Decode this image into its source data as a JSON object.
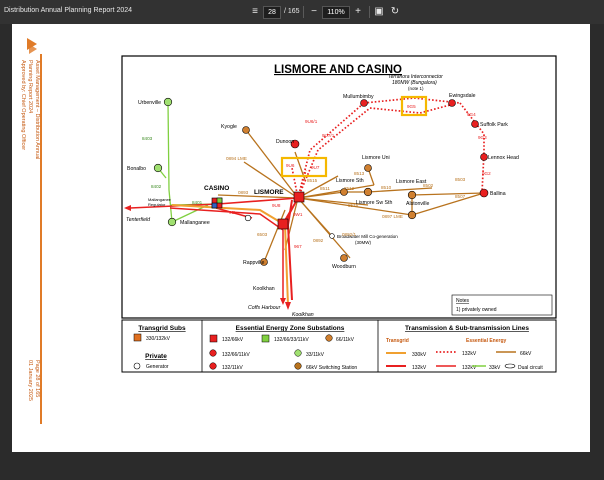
{
  "toolbar": {
    "title": "Distribution Annual Planning Report 2024",
    "page_current": "28",
    "page_total": "/ 165",
    "zoom": "110%",
    "icons": [
      "menu-icon",
      "zoom-out-icon",
      "zoom-in-icon",
      "fit-page-icon",
      "rotate-icon"
    ]
  },
  "sidebar": {
    "lines": [
      "Asset Management – Distribution Annual",
      "Planning Report 2024",
      "Approved by: Chief Operating Officer"
    ],
    "page_lines": [
      "Page 28 of 165",
      "01 January 2025"
    ]
  },
  "map": {
    "title": "LISMORE AND CASINO",
    "towns": {
      "urbenville": "Urbenville",
      "bonalbo": "Bonalbo",
      "casino": "CASINO",
      "mallanganee": "Mallanganee",
      "mallanganee_reg": "Mallanganee",
      "mallanganee_reg2": "Regulator",
      "tenterfield": "Tenterfield",
      "kyogle": "Kyogle",
      "dunoon": "Dunoon",
      "lismore": "LISMORE",
      "lismore_uni": "Lismore Uni",
      "lismore_sth": "Lismore Sth",
      "lismore_east": "Lismore East",
      "lismore_sw": "Lismore Sw Sth",
      "alstonville": "Alstonville",
      "ballina": "Ballina",
      "lennox": "Lennox Head",
      "suffolk": "Suffolk Park",
      "ewingsdale": "Ewingsdale",
      "mullumbimby": "Mullumbimby",
      "rappville": "Rappville",
      "woodburn": "Woodburn",
      "koolkhan": "Koolkhan",
      "koolkhan2": "Koolkhan",
      "coffs": "Coffs Harbour",
      "broadwater": "Broadwater Mill Co-generation",
      "broadwater2": "(30MW)",
      "terranora1": "Terranora Interconnector",
      "terranora2": "180MW (Bungalora)",
      "terranora3": "(note 1)"
    },
    "lines": {
      "l8403": "8403",
      "l8402": "8402",
      "l8401": "8401",
      "l96l": "96L",
      "l8U1": "8U1",
      "l8U3": "8U3",
      "l8U5": "8U5",
      "l9U8": "9U8",
      "l9W1": "9W1",
      "l967": "967",
      "l9U6_1": "9U6/1",
      "l9U7_1": "9U7/1",
      "l9G5": "9G5",
      "l9G4": "9G4",
      "l9G3": "9G3",
      "l9G2": "9G2",
      "l9U6": "9U6",
      "l9U7": "9U7",
      "l0894": "0894 LME",
      "l0893": "0893",
      "l8515": "8515",
      "l8511": "8511",
      "l8513": "8513",
      "l8512": "8512",
      "l8516": "8516",
      "l8510": "8510",
      "l8502": "8502",
      "l8503": "8503",
      "l8507": "8507",
      "l0897": "0897 LME",
      "l0892_1": "0892/1",
      "l0892": "0892",
      "l6503": "6503",
      "l8501": "8501"
    },
    "notes_title": "Notes",
    "notes_item": "1)      privately owned"
  },
  "legend": {
    "transgrid_title": "Transgrid Subs",
    "transgrid_item": "330/132kV",
    "private_title": "Private",
    "generator": "Generator",
    "ee_title": "Essential Energy Zone Substations",
    "ee_items": [
      "132/66kV",
      "132/66/33/11kV",
      "66/11kV",
      "132/66/11kV",
      "33/11kV",
      "132/11kV",
      "66kV Switching Station"
    ],
    "tx_title": "Transmission & Sub-transmission Lines",
    "tx_transgrid": "Transgrid",
    "tx_essential": "Essential Energy",
    "tx_items": [
      "330kV",
      "132kV",
      "132kV",
      "66kV",
      "132kV",
      "33kV",
      "Dual circuit"
    ]
  },
  "colors": {
    "transgrid_line": "#f0a030",
    "red_line": "#e82020",
    "red_dotted": "#e82020",
    "brown_line": "#b8731e",
    "green_line": "#80d040",
    "highlight_box": "#f5b800",
    "accent_orange": "#c65a11"
  }
}
